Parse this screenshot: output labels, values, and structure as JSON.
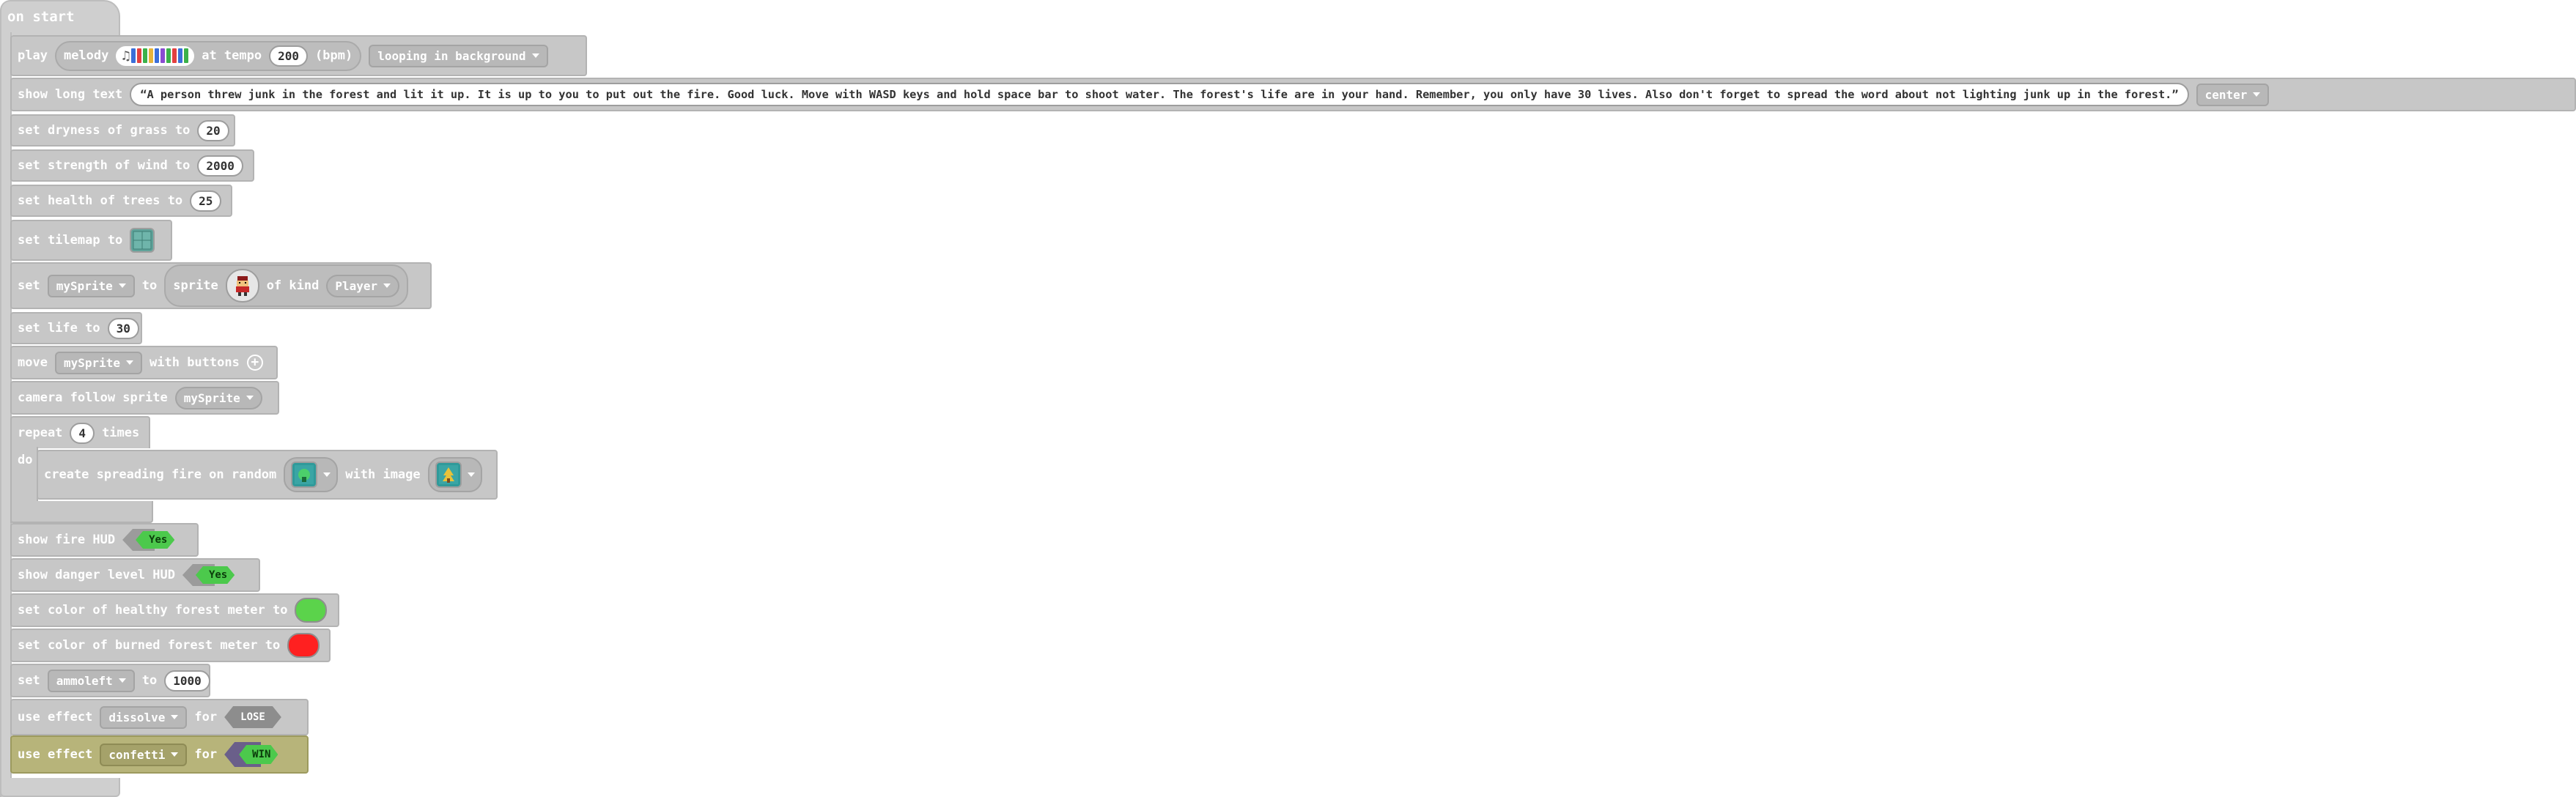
{
  "hat": {
    "label": "on start"
  },
  "play": {
    "label": "play",
    "melody_label": "melody",
    "at_tempo": "at tempo",
    "tempo": "200",
    "bpm": "(bpm)",
    "mode": "looping in background",
    "melody_colors": [
      "#3b6fd9",
      "#e34040",
      "#3bb14a",
      "#e8b43a",
      "#3b6fd9",
      "#8a4bd1",
      "#3bb14a",
      "#e34040",
      "#3b6fd9",
      "#3bb14a"
    ]
  },
  "longtext": {
    "label": "show long text",
    "text": "“A person threw junk in the forest and lit it up. It is up to you to put out the fire. Good luck. Move with WASD keys and hold space bar to shoot water. The forest's life are in your hand. Remember, you only have 30 lives. Also don't forget to spread the word about not lighting junk up in the forest.”",
    "align": "center"
  },
  "dryness": {
    "label": "set dryness of grass to",
    "value": "20"
  },
  "wind": {
    "label": "set strength of wind to",
    "value": "2000"
  },
  "health": {
    "label": "set health of trees to",
    "value": "25"
  },
  "tilemap": {
    "label": "set tilemap to"
  },
  "setsprite": {
    "set": "set",
    "var": "mySprite",
    "to": "to",
    "sprite": "sprite",
    "of_kind": "of kind",
    "kind": "Player"
  },
  "life": {
    "label": "set life to",
    "value": "30"
  },
  "move": {
    "label": "move",
    "var": "mySprite",
    "with": "with buttons"
  },
  "camera": {
    "label": "camera follow sprite",
    "var": "mySprite"
  },
  "repeat": {
    "label": "repeat",
    "value": "4",
    "times": "times",
    "do": "do"
  },
  "fire": {
    "label": "create spreading fire on random",
    "with_image": "with image"
  },
  "firehud": {
    "label": "show fire HUD",
    "toggle": "Yes"
  },
  "dangerhud": {
    "label": "show danger level HUD",
    "toggle": "Yes"
  },
  "healthy": {
    "label": "set color of healthy forest meter to",
    "color": "#5bd34b"
  },
  "burned": {
    "label": "set color of burned forest meter to",
    "color": "#ff2020"
  },
  "ammo": {
    "set": "set",
    "var": "ammoleft",
    "to": "to",
    "value": "1000"
  },
  "effect1": {
    "label": "use effect",
    "effect": "dissolve",
    "for": "for",
    "target": "LOSE"
  },
  "effect2": {
    "label": "use effect",
    "effect": "confetti",
    "for": "for",
    "target": "WIN"
  },
  "colors": {
    "block": "#c7c7c7",
    "highlight_block": "#b7b47a",
    "toggle_on": "#4cc94c",
    "lose_hex": "#8d8d8d",
    "win_hex": "#6a5f8a"
  }
}
